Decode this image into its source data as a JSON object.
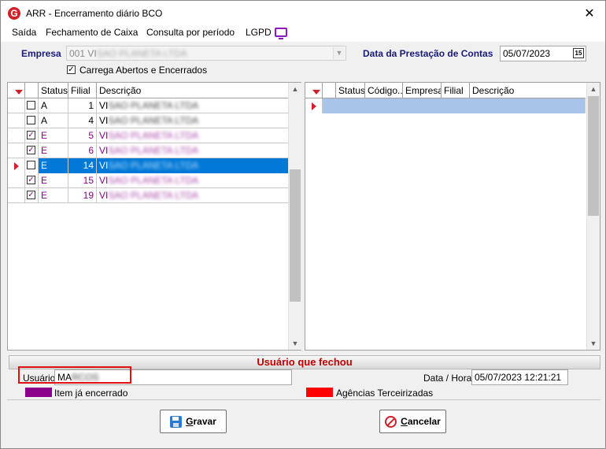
{
  "window": {
    "title": "ARR -  Encerramento diário BCO",
    "close_glyph": "✕",
    "app_icon_letter": "G"
  },
  "menu": {
    "items": [
      "Saída",
      "Fechamento de Caixa",
      "Consulta por período",
      "LGPD"
    ]
  },
  "filters": {
    "empresa_label": "Empresa",
    "empresa_value": "001 VI",
    "empresa_value_masked": "SAO PLANETA LTDA",
    "data_label": "Data da Prestação de Contas",
    "data_value": "05/07/2023",
    "calendar_day": "15",
    "carrega_label": "Carrega Abertos e Encerrados",
    "carrega_checked": true
  },
  "left_grid": {
    "columns": [
      "Status",
      "Filial",
      "Descrição"
    ],
    "rows": [
      {
        "checked": false,
        "status": "A",
        "filial": "1",
        "desc_prefix": "VI",
        "closed": false,
        "selected": false
      },
      {
        "checked": false,
        "status": "A",
        "filial": "4",
        "desc_prefix": "VI",
        "closed": false,
        "selected": false
      },
      {
        "checked": true,
        "status": "E",
        "filial": "5",
        "desc_prefix": "VI",
        "closed": true,
        "selected": false
      },
      {
        "checked": true,
        "status": "E",
        "filial": "6",
        "desc_prefix": "VI",
        "closed": true,
        "selected": false
      },
      {
        "checked": true,
        "status": "E",
        "filial": "14",
        "desc_prefix": "VI",
        "closed": true,
        "selected": true
      },
      {
        "checked": true,
        "status": "E",
        "filial": "15",
        "desc_prefix": "VI",
        "closed": true,
        "selected": false
      },
      {
        "checked": true,
        "status": "E",
        "filial": "19",
        "desc_prefix": "VI",
        "closed": true,
        "selected": false
      }
    ],
    "masked_desc": "SAO PLANETA LTDA"
  },
  "right_grid": {
    "columns": [
      "Status",
      "Código...",
      "Empresa",
      "Filial",
      "Descrição"
    ]
  },
  "section": {
    "title": "Usuário que fechou"
  },
  "user": {
    "usuario_label": "Usuário",
    "usuario_value": "MA",
    "usuario_masked": "RCOS",
    "datahora_label": "Data / Hora",
    "datahora_value": "05/07/2023 12:21:21"
  },
  "legend": {
    "closed_label": "Item já encerrado",
    "closed_color": "#8b008b",
    "third_label": "Agências Terceirizadas",
    "third_color": "#ff0000"
  },
  "buttons": {
    "save_underline": "G",
    "save_rest": "ravar",
    "cancel_underline": "C",
    "cancel_rest": "ancelar"
  },
  "colors": {
    "accent": "#1a1a7a",
    "selected": "#0078d7",
    "highlight_box": "#e01010"
  }
}
